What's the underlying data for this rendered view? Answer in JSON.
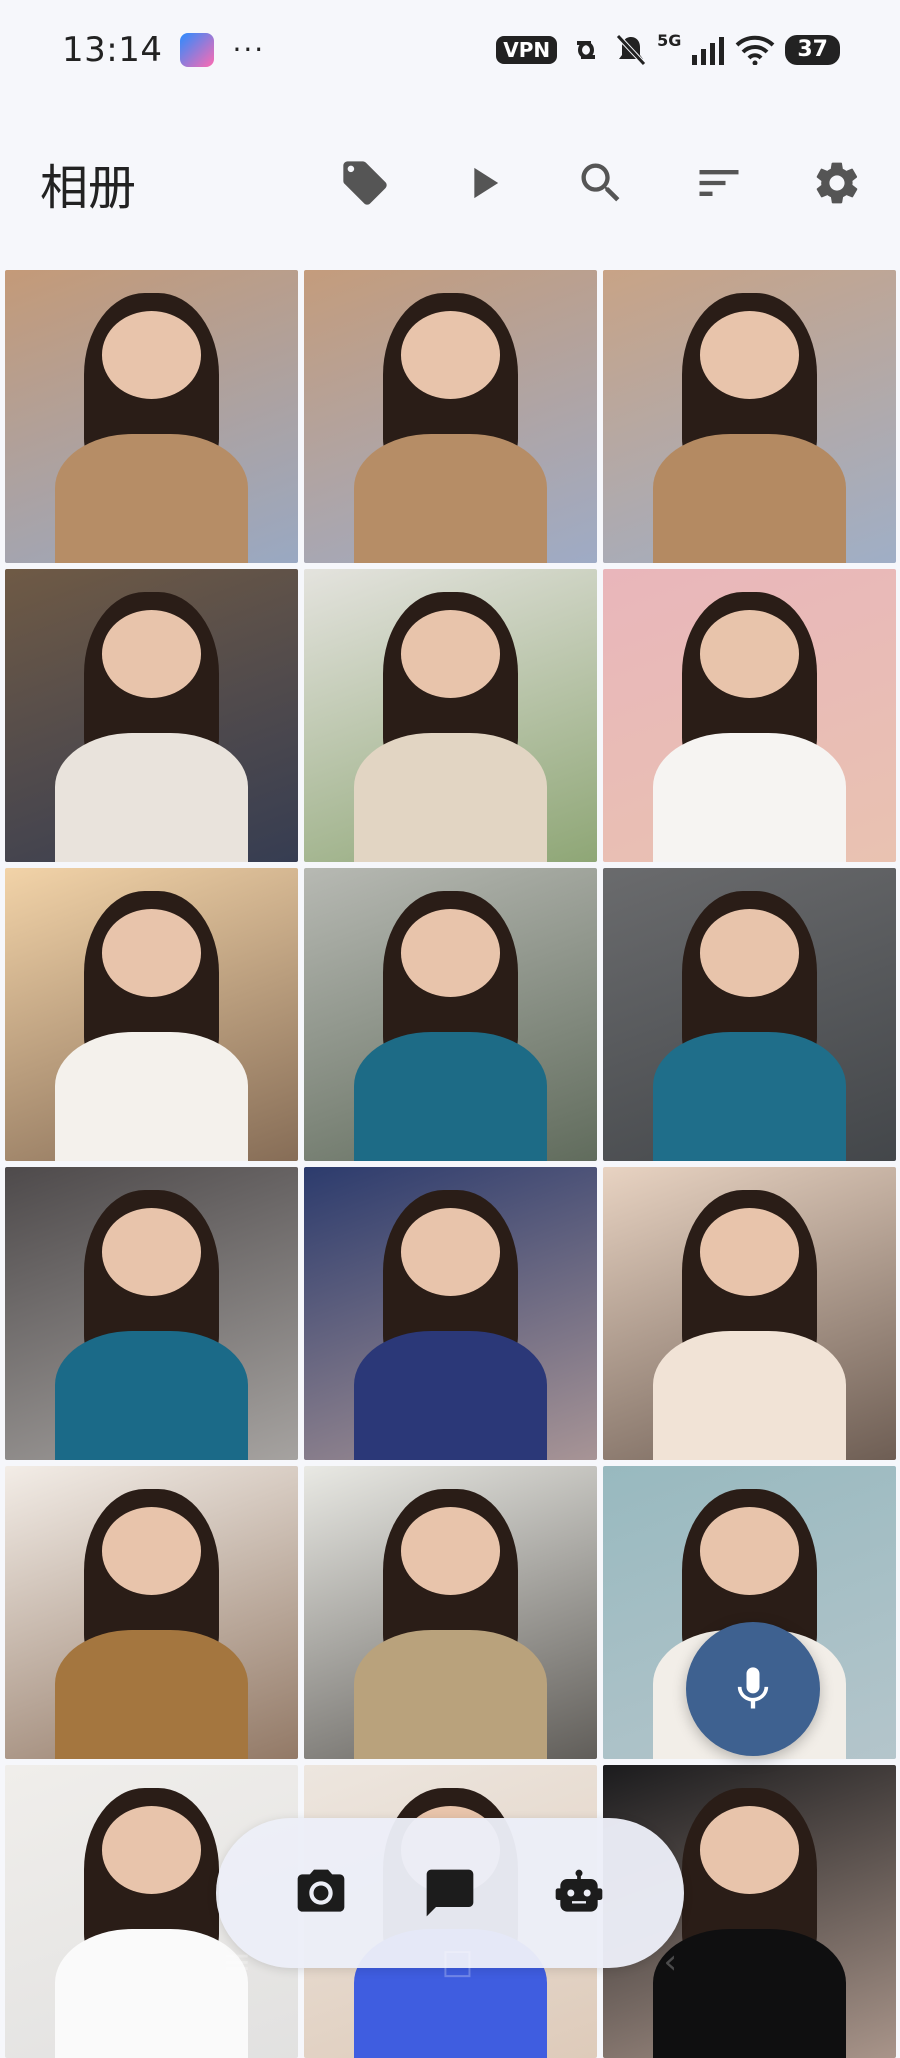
{
  "status_bar": {
    "time": "13:14",
    "overflow": "···",
    "vpn": "VPN",
    "network": "5G",
    "battery": "37",
    "icons": [
      "app-badge-icon",
      "link-icon",
      "bell-off-icon",
      "signal-icon",
      "wifi-icon",
      "battery-icon"
    ]
  },
  "app_bar": {
    "title": "相册",
    "actions": [
      "tag-icon",
      "play-icon",
      "search-icon",
      "sort-icon",
      "settings-icon"
    ]
  },
  "photos": [
    {
      "bg": "#c49a78",
      "body": "#b68d66",
      "accent": "#88aee0"
    },
    {
      "bg": "#c49c7c",
      "body": "#b68d66",
      "accent": "#8fb1e3"
    },
    {
      "bg": "#c8a386",
      "body": "#b48a62",
      "accent": "#8fb3e0"
    },
    {
      "bg": "#6f5a45",
      "body": "#e9e3dc",
      "accent": "#1f3157"
    },
    {
      "bg": "#e4e3de",
      "body": "#e2d5c3",
      "accent": "#6c8e4c"
    },
    {
      "bg": "#e9b6bb",
      "body": "#f6f4f2",
      "accent": "#e9c7ad"
    },
    {
      "bg": "#f2d3a8",
      "body": "#f4f1ec",
      "accent": "#5b4436"
    },
    {
      "bg": "#b7b9b3",
      "body": "#1d6b86",
      "accent": "#3e4d3a"
    },
    {
      "bg": "#6a6b6d",
      "body": "#1f6e8a",
      "accent": "#34383c"
    },
    {
      "bg": "#4e4a4b",
      "body": "#1b6a88",
      "accent": "#c9c6c2"
    },
    {
      "bg": "#2c3b6d",
      "body": "#2b3878",
      "accent": "#d9b8a6"
    },
    {
      "bg": "#e8d3c2",
      "body": "#f1e3d6",
      "accent": "#3d2f28"
    },
    {
      "bg": "#f3ede7",
      "body": "#a4763f",
      "accent": "#6c4b33"
    },
    {
      "bg": "#e9e9e4",
      "body": "#b9a27c",
      "accent": "#2a2622"
    },
    {
      "bg": "#98b9bf",
      "body": "#f2eee8",
      "accent": "#bfcad0"
    },
    {
      "bg": "#f0eeeb",
      "body": "#fafafa",
      "accent": "#dcdcdc"
    },
    {
      "bg": "#ede6df",
      "body": "#3f5de0",
      "accent": "#d8c0ab"
    },
    {
      "bg": "#1b1b1d",
      "body": "#0f0f10",
      "accent": "#e1c5b5"
    }
  ],
  "fab": {
    "icon": "microphone-icon"
  },
  "bottom_bar": {
    "icons": [
      "camera-icon",
      "chat-icon",
      "robot-icon"
    ]
  }
}
